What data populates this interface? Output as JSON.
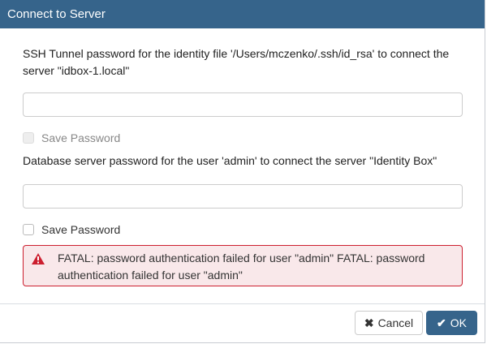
{
  "dialog": {
    "title": "Connect to Server"
  },
  "ssh": {
    "label": "SSH Tunnel password for the identity file '/Users/mczenko/.ssh/id_rsa' to connect the server \"idbox-1.local\"",
    "value": "",
    "save_label": "Save Password",
    "save_checked": false,
    "save_disabled": true
  },
  "db": {
    "label": "Database server password for the user 'admin' to connect the server \"Identity Box\"",
    "value": "",
    "save_label": "Save Password",
    "save_checked": false
  },
  "error": {
    "icon": "warning-triangle-icon",
    "message": "FATAL: password authentication failed for user \"admin\" FATAL: password authentication failed for user \"admin\"",
    "color": "#cc1f2f"
  },
  "footer": {
    "cancel_label": "Cancel",
    "ok_label": "OK"
  },
  "colors": {
    "header": "#36648b",
    "primary": "#36648b"
  }
}
